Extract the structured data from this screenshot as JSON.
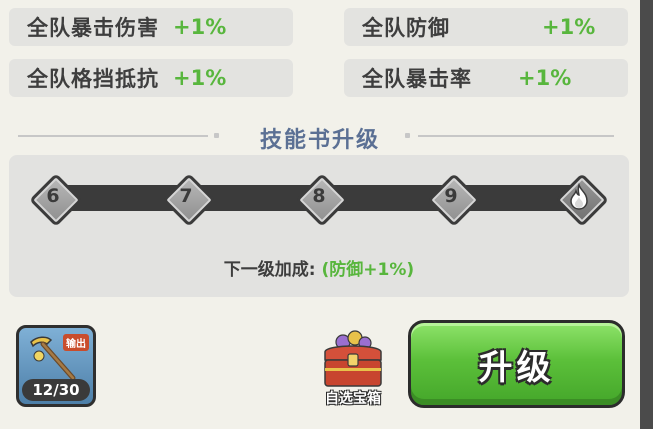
{
  "stats": [
    {
      "name": "全队暴击伤害",
      "value": "+1%"
    },
    {
      "name": "全队防御",
      "value": "+1%"
    },
    {
      "name": "全队格挡抵抗",
      "value": "+1%"
    },
    {
      "name": "全队暴击率",
      "value": "+1%"
    }
  ],
  "section_title": "技能书升级",
  "levels": [
    "6",
    "7",
    "8",
    "9"
  ],
  "max_node_icon": "flame-icon",
  "bonus": {
    "label": "下一级加成:",
    "value": "(防御+1%)"
  },
  "item": {
    "tag": "输出",
    "count": "12/30",
    "icon": "pickaxe-icon"
  },
  "chest": {
    "label": "自选宝箱",
    "icon": "treasure-chest-icon"
  },
  "upgrade_button": "升级",
  "colors": {
    "green": "#58b63d",
    "title": "#5b7094",
    "button": "#5cc03a"
  }
}
